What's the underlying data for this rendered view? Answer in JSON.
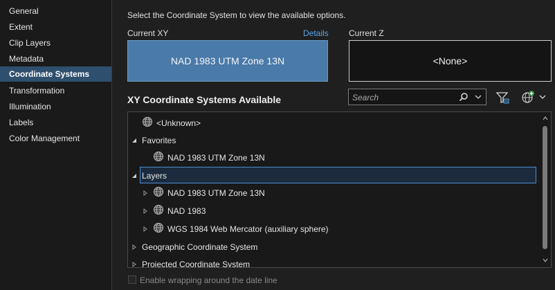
{
  "sidebar": {
    "items": [
      {
        "label": "General"
      },
      {
        "label": "Extent"
      },
      {
        "label": "Clip Layers"
      },
      {
        "label": "Metadata"
      },
      {
        "label": "Coordinate Systems",
        "selected": true
      },
      {
        "label": "Transformation"
      },
      {
        "label": "Illumination"
      },
      {
        "label": "Labels"
      },
      {
        "label": "Color Management"
      }
    ]
  },
  "main": {
    "instruction": "Select the Coordinate System to view the available options.",
    "current_xy": {
      "label": "Current XY",
      "details_link": "Details",
      "value": "NAD 1983 UTM Zone 13N"
    },
    "current_z": {
      "label": "Current Z",
      "value": "<None>"
    },
    "section_title": "XY Coordinate Systems Available",
    "search": {
      "placeholder": "Search"
    },
    "tree": [
      {
        "label": "<Unknown>",
        "level": 0,
        "icon": "globe-icon"
      },
      {
        "label": "Favorites",
        "level": 0,
        "expanded": true
      },
      {
        "label": "NAD 1983 UTM Zone 13N",
        "level": 1,
        "icon": "globe-icon"
      },
      {
        "label": "Layers",
        "level": 0,
        "expanded": true,
        "selected": true
      },
      {
        "label": "NAD 1983 UTM Zone 13N",
        "level": 1,
        "icon": "globe-icon",
        "collapsed": true
      },
      {
        "label": "NAD 1983",
        "level": 1,
        "icon": "globe-icon",
        "collapsed": true
      },
      {
        "label": "WGS 1984 Web Mercator (auxiliary sphere)",
        "level": 1,
        "icon": "globe-icon",
        "collapsed": true
      },
      {
        "label": "Geographic Coordinate System",
        "level": 0,
        "collapsed": true
      },
      {
        "label": "Projected Coordinate System",
        "level": 0,
        "collapsed": true
      }
    ],
    "wrap_option": {
      "label": "Enable wrapping around the date line",
      "checked": false,
      "enabled": false
    }
  },
  "colors": {
    "accent": "#4a7aa8",
    "selection_border": "#4c8fd0",
    "link": "#5aa6e6"
  }
}
